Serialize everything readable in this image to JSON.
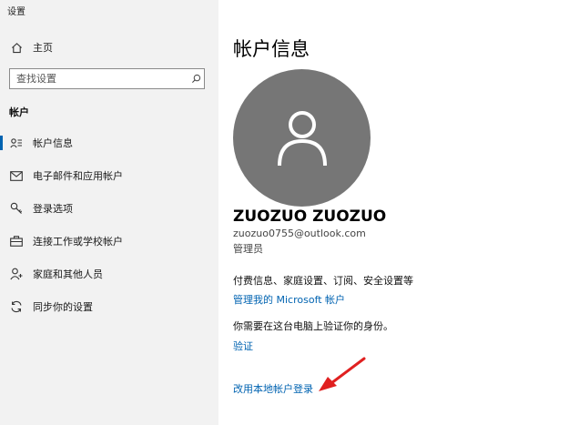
{
  "window": {
    "title": "设置"
  },
  "sidebar": {
    "home_label": "主页",
    "search_placeholder": "查找设置",
    "section_label": "帐户",
    "items": [
      {
        "label": "帐户信息",
        "icon": "account-info-icon",
        "selected": true
      },
      {
        "label": "电子邮件和应用帐户",
        "icon": "mail-icon",
        "selected": false
      },
      {
        "label": "登录选项",
        "icon": "key-icon",
        "selected": false
      },
      {
        "label": "连接工作或学校帐户",
        "icon": "briefcase-icon",
        "selected": false
      },
      {
        "label": "家庭和其他人员",
        "icon": "person-add-icon",
        "selected": false
      },
      {
        "label": "同步你的设置",
        "icon": "sync-icon",
        "selected": false
      }
    ]
  },
  "main": {
    "title": "帐户信息",
    "user_name": "ZUOZUO ZUOZUO",
    "email": "zuozuo0755@outlook.com",
    "role": "管理员",
    "billing_text": "付费信息、家庭设置、订阅、安全设置等",
    "manage_link": "管理我的 Microsoft 帐户",
    "verify_text": "你需要在这台电脑上验证你的身份。",
    "verify_link": "验证",
    "local_account_link": "改用本地帐户登录"
  },
  "colors": {
    "sidebar_bg": "#f2f2f2",
    "accent": "#0063b1",
    "avatar_bg": "#767676",
    "arrow": "#e02020"
  }
}
